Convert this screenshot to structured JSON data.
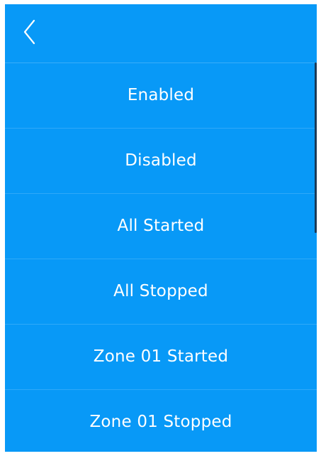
{
  "header": {
    "back_icon": "chevron-left-icon"
  },
  "list": {
    "items": [
      {
        "label": "Enabled"
      },
      {
        "label": "Disabled"
      },
      {
        "label": "All Started"
      },
      {
        "label": "All Stopped"
      },
      {
        "label": "Zone 01 Started"
      },
      {
        "label": "Zone 01 Stopped"
      }
    ]
  },
  "colors": {
    "background": "#0899f7",
    "text": "#ffffff",
    "divider": "rgba(255,255,255,0.16)",
    "scrollbar": "#1b3a57"
  }
}
